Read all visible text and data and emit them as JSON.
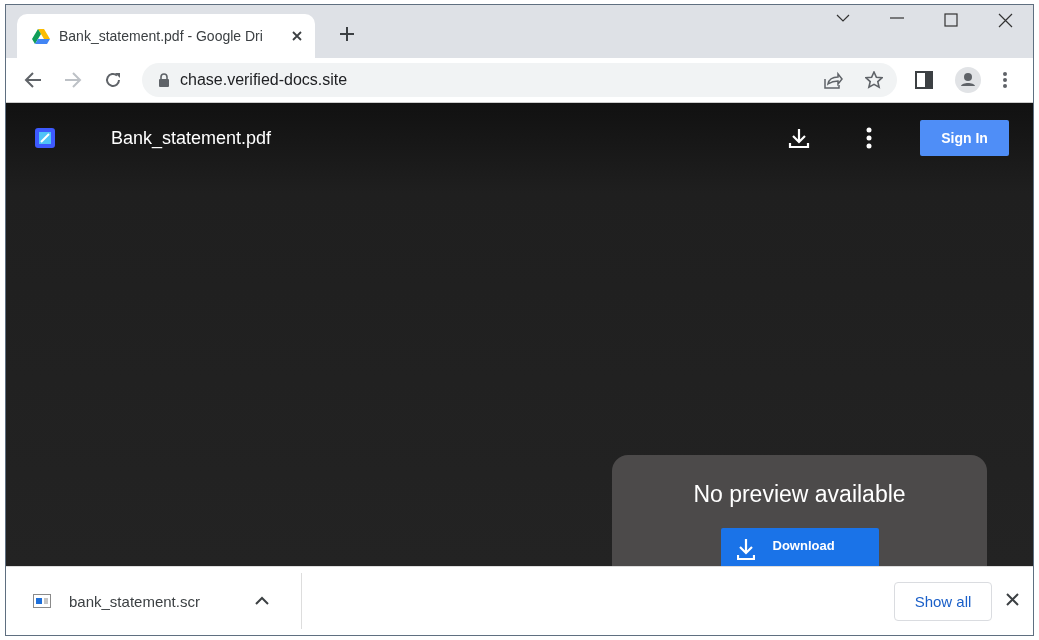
{
  "tabs": [
    {
      "title": "Bank_statement.pdf - Google Dri",
      "selected": true
    }
  ],
  "address_bar": {
    "url": "chase.verified-docs.site"
  },
  "viewer": {
    "file_name": "Bank_statement.pdf",
    "sign_in": "Sign In",
    "card": {
      "title": "No preview available",
      "download_button": "Download"
    }
  },
  "download_shelf": {
    "file_name": "bank_statement.scr",
    "show_all": "Show all"
  }
}
